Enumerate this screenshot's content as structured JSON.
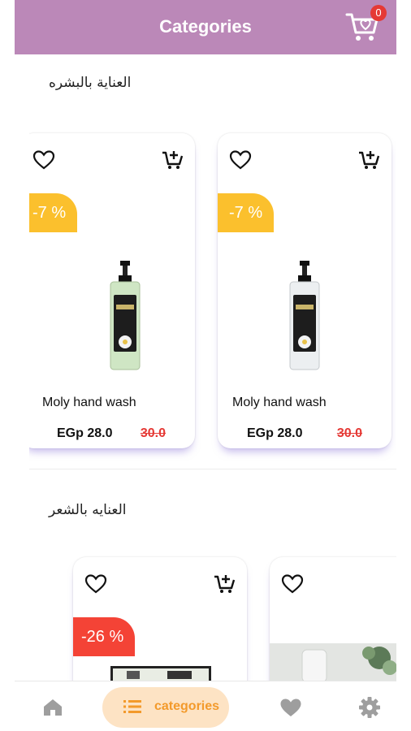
{
  "header": {
    "title": "Categories",
    "cart_count": "0"
  },
  "sections": [
    {
      "title": "العناية بالبشره",
      "products": [
        {
          "name": "Moly hand wash",
          "price": "EGp 28.0",
          "old_price": "30.0",
          "discount": "-7 %"
        },
        {
          "name": "Moly hand wash",
          "price": "EGp 28.0",
          "old_price": "30.0",
          "discount": "-7 %"
        }
      ]
    },
    {
      "title": "العنايه بالشعر",
      "products": [
        {
          "discount": "-26 %"
        },
        {}
      ]
    }
  ],
  "bottom_nav": {
    "active_label": "categories"
  },
  "colors": {
    "appbar": "#bb88b8",
    "discount_yellow": "#fbc02d",
    "discount_red": "#f44336",
    "nav_active_bg": "#fde3c4",
    "nav_active_text": "#f39a2b"
  }
}
